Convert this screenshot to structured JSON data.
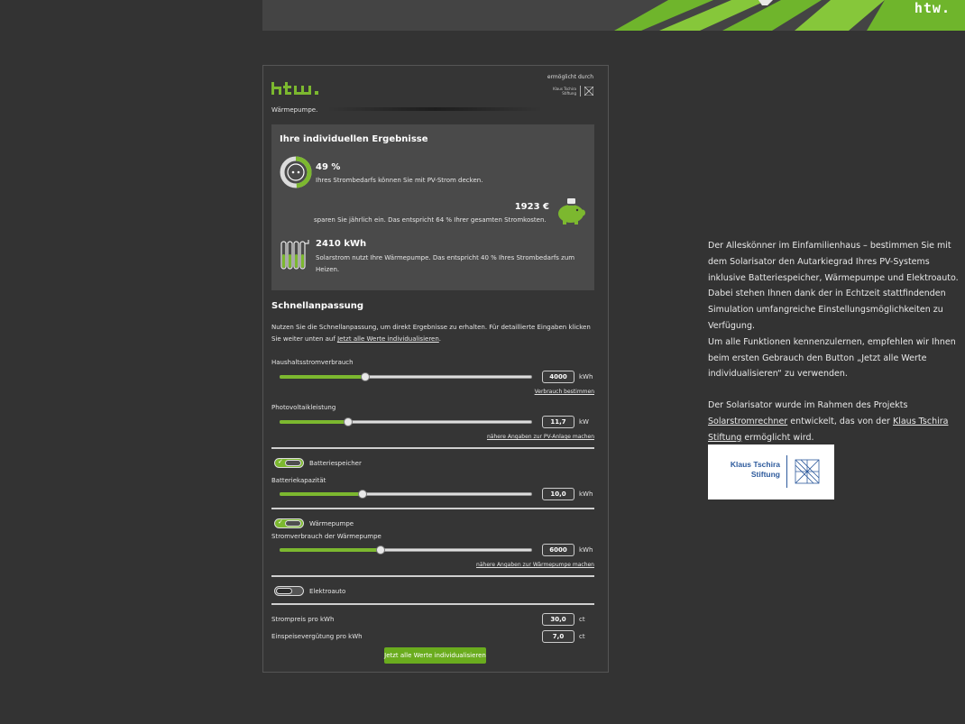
{
  "banner": {
    "logo": "htw."
  },
  "widget": {
    "sponsor_label": "ermöglicht durch",
    "sponsor_mini": "Klaus Tschira Stiftung",
    "intro": "Wärmepumpe.",
    "results": {
      "title": "Ihre individuellen Ergebnisse",
      "autarky_value": "49 %",
      "autarky_text": "Ihres Strombedarfs können Sie mit PV-Strom decken.",
      "autarky_fraction": 0.49,
      "savings_value": "1923 €",
      "savings_text": "sparen Sie jährlich ein. Das entspricht 64 % Ihrer gesamten Stromkosten.",
      "heatpump_value": "2410 kWh",
      "heatpump_text": "Solarstrom nutzt Ihre Wärmepumpe. Das entspricht 40 % Ihres Strombedarfs zum Heizen."
    },
    "quick": {
      "title": "Schnellanpassung",
      "desc": "Nutzen Sie die Schnellanpassung, um direkt Ergebnisse zu erhalten. Für detaillierte Eingaben klicken Sie weiter unten auf ",
      "desc_link": "Jetzt alle Werte individualisieren",
      "desc_end": "."
    },
    "household": {
      "label": "Haushaltsstromverbrauch",
      "value": "4000",
      "unit": "kWh",
      "link": "Verbrauch bestimmen",
      "fraction": 0.34
    },
    "pv": {
      "label": "Photovoltaikleistung",
      "value": "11,7",
      "unit": "kW",
      "link": "nähere Angaben zur PV-Anlage machen",
      "fraction": 0.27
    },
    "battery": {
      "toggle_label": "Batteriespeicher",
      "on": true,
      "label": "Batteriekapazität",
      "value": "10,0",
      "unit": "kWh",
      "fraction": 0.33
    },
    "heatpump": {
      "toggle_label": "Wärmepumpe",
      "on": true,
      "label": "Stromverbrauch der Wärmepumpe",
      "value": "6000",
      "unit": "kWh",
      "link": "nähere Angaben zur Wärmepumpe machen",
      "fraction": 0.4
    },
    "ev": {
      "toggle_label": "Elektroauto",
      "on": false
    },
    "price": {
      "label": "Strompreis pro kWh",
      "value": "30,0",
      "unit": "ct"
    },
    "feedin": {
      "label": "Einspeisevergütung pro kWh",
      "value": "7,0",
      "unit": "ct"
    },
    "cta": "Jetzt alle Werte individualisieren"
  },
  "side": {
    "p1": "Der Alleskönner im Einfamilienhaus – bestimmen Sie mit dem Solarisator den Autarkiegrad Ihres PV-Systems inklusive Batteriespeicher, Wärmepumpe und Elektroauto. Dabei stehen Ihnen dank der in Echtzeit stattfindenden Simulation umfangreiche Einstellungsmöglichkeiten zu Verfügung.",
    "p2": "Um alle Funktionen kennenzulernen, empfehlen wir Ihnen beim ersten Gebrauch den Button „Jetzt alle Werte individualisieren“ zu verwenden.",
    "p3_a": "Der Solarisator wurde im Rahmen des Projekts ",
    "p3_link1": "Solarstromrechner",
    "p3_b": " entwickelt, das von der ",
    "p3_link2": "Klaus Tschira Stiftung",
    "p3_c": " ermöglicht wird.",
    "logo_text": "Klaus Tschira Stiftung"
  },
  "colors": {
    "accent": "#7cb82f",
    "background": "#333333",
    "panel": "#4a4a4a"
  }
}
